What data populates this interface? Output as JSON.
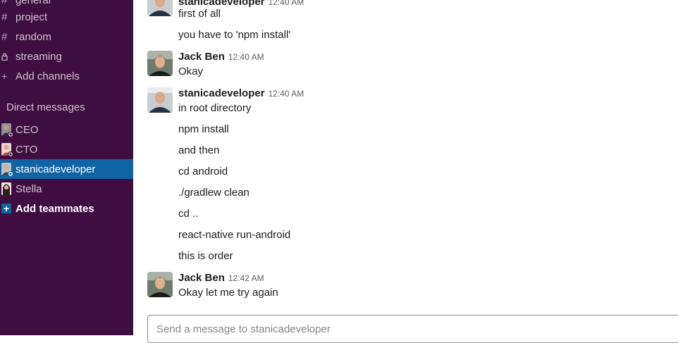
{
  "sidebar": {
    "channels": [
      {
        "prefix": "#",
        "label": "general"
      },
      {
        "prefix": "#",
        "label": "project"
      },
      {
        "prefix": "#",
        "label": "random"
      },
      {
        "prefix": "lock",
        "label": "streaming"
      }
    ],
    "add_channels_label": "Add channels",
    "direct_messages_heading": "Direct messages",
    "dms": [
      {
        "label": "CEO"
      },
      {
        "label": "CTO"
      },
      {
        "label": "stanicadeveloper"
      },
      {
        "label": "Stella"
      }
    ],
    "add_teammates_label": "Add teammates"
  },
  "messages": {
    "groups": [
      {
        "author": "stanicadeveloper",
        "time": "12:40 AM",
        "lines": [
          "first of all",
          "you have to  'npm install'"
        ]
      },
      {
        "author": "Jack Ben",
        "time": "12:40 AM",
        "lines": [
          "Okay"
        ]
      },
      {
        "author": "stanicadeveloper",
        "time": "12:40 AM",
        "lines": [
          "in root directory",
          "npm install",
          "and then",
          "cd android",
          "./gradlew clean",
          "cd ..",
          "react-native run-android",
          "this is order"
        ]
      },
      {
        "author": "Jack Ben",
        "time": "12:42 AM",
        "lines": [
          "Okay let me try again"
        ]
      }
    ]
  },
  "composer": {
    "placeholder": "Send a message to stanicadeveloper"
  },
  "colors": {
    "sidebar_bg": "#3f0e40",
    "active_item": "#1164a3"
  }
}
